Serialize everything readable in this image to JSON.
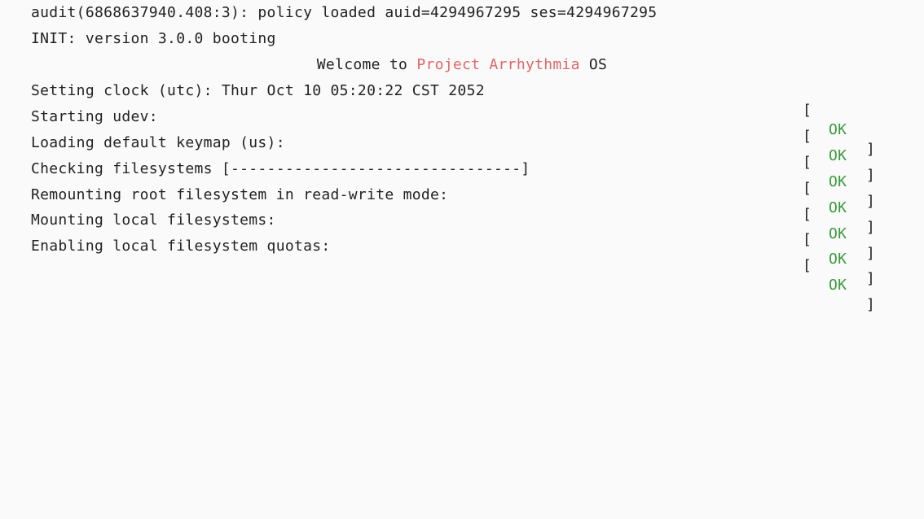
{
  "boot": {
    "audit_line": "audit(6868637940.408:3): policy loaded auid=4294967295 ses=4294967295",
    "init_line": "INIT: version 3.0.0 booting",
    "welcome_prefix": "Welcome to ",
    "welcome_brand": "Project Arrhythmia",
    "welcome_suffix": " OS",
    "brand_color": "#e06666",
    "ok_color": "#3a9a3a",
    "status_open": "[",
    "status_close": "]",
    "steps": [
      {
        "text": "Setting clock (utc): Thur Oct 10 05:20:22 CST 2052",
        "status": "OK"
      },
      {
        "text": "Starting udev:",
        "status": "OK"
      },
      {
        "text": "Loading default keymap (us):",
        "status": "OK"
      },
      {
        "text": "Checking filesystems [--------------------------------]",
        "status": "OK"
      },
      {
        "text": "Remounting root filesystem in read-write mode:",
        "status": "OK"
      },
      {
        "text": "Mounting local filesystems:",
        "status": "OK"
      },
      {
        "text": "Enabling local filesystem quotas:",
        "status": "OK"
      }
    ]
  }
}
